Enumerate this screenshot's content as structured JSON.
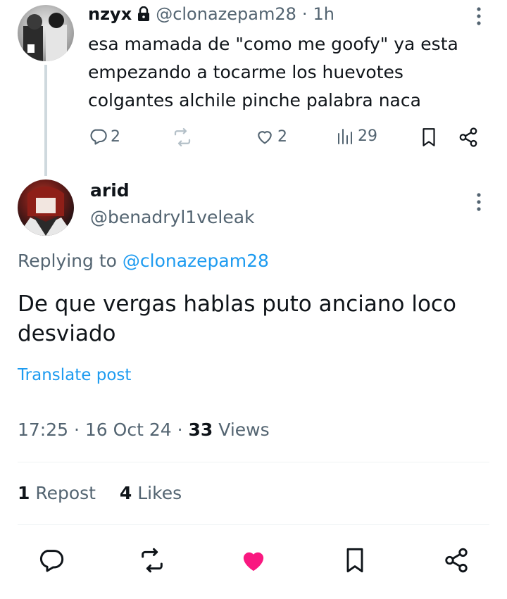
{
  "parent": {
    "name": "nzyx",
    "handle": "@clonazepam28",
    "separator": "·",
    "time": "1h",
    "text": "esa mamada de \"como me goofy\" ya esta empezando a tocarme los huevotes colgantes alchile pinche palabra naca",
    "replies": "2",
    "likes": "2",
    "views": "29"
  },
  "reply": {
    "name": "arid",
    "handle": "@benadryl1veleak",
    "replying_prefix": "Replying to",
    "replying_to": "@clonazepam28",
    "text": "De que vergas hablas puto anciano loco desviado",
    "translate": "Translate post",
    "time": "17:25",
    "sep1": "·",
    "date": "16 Oct 24",
    "sep2": "·",
    "views_count": "33",
    "views_label": "Views",
    "reposts_count": "1",
    "reposts_label": "Repost",
    "likes_count": "4",
    "likes_label": "Likes"
  },
  "colors": {
    "accent": "#1d9bf0",
    "like": "#f91880",
    "muted": "#536471",
    "text": "#0f1419"
  }
}
